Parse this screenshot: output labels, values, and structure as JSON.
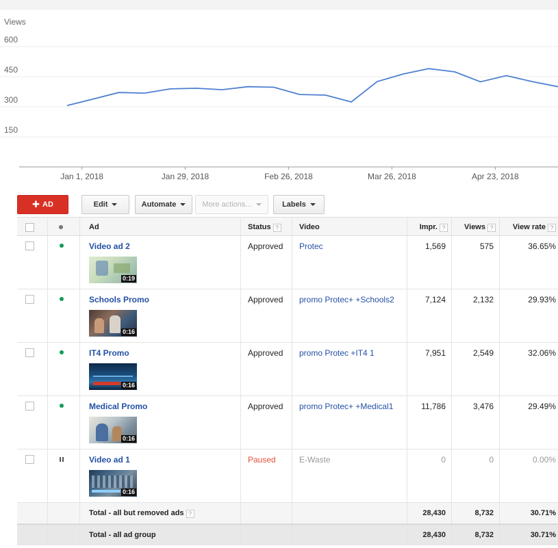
{
  "chart_data": {
    "type": "line",
    "ylabel": "Views",
    "yticks": [
      600,
      450,
      300,
      150
    ],
    "ylim": [
      0,
      650
    ],
    "xticks": [
      "Jan 1, 2018",
      "Jan 29, 2018",
      "Feb 26, 2018",
      "Mar 26, 2018",
      "Apr 23, 2018"
    ],
    "x": [
      "2017-12-28",
      "2018-01-04",
      "2018-01-11",
      "2018-01-18",
      "2018-01-25",
      "2018-02-01",
      "2018-02-08",
      "2018-02-15",
      "2018-02-22",
      "2018-03-01",
      "2018-03-08",
      "2018-03-15",
      "2018-03-22",
      "2018-03-29",
      "2018-04-05",
      "2018-04-12",
      "2018-04-19",
      "2018-04-26",
      "2018-05-03",
      "2018-05-10"
    ],
    "values": [
      306,
      338,
      371,
      368,
      389,
      392,
      385,
      400,
      397,
      361,
      358,
      324,
      425,
      463,
      490,
      474,
      424,
      455,
      425,
      400
    ],
    "color": "#4d7fd1",
    "grid": true
  },
  "toolbar": {
    "add_label": "AD",
    "edit_label": "Edit",
    "automate_label": "Automate",
    "more_label": "More actions...",
    "labels_label": "Labels"
  },
  "table": {
    "headers": {
      "ad": "Ad",
      "status": "Status",
      "video": "Video",
      "impr": "Impr.",
      "views": "Views",
      "view_rate": "View rate"
    },
    "help_glyph": "?",
    "rows": [
      {
        "name": "Video ad 2",
        "duration": "0:19",
        "status": "Approved",
        "video": "Protec",
        "impr": "1,569",
        "views": "575",
        "view_rate": "36.65%"
      },
      {
        "name": "Schools Promo",
        "duration": "0:16",
        "status": "Approved",
        "video": "promo Protec+ +Schools2",
        "impr": "7,124",
        "views": "2,132",
        "view_rate": "29.93%"
      },
      {
        "name": "IT4 Promo",
        "duration": "0:16",
        "status": "Approved",
        "video": "promo Protec +IT4 1",
        "impr": "7,951",
        "views": "2,549",
        "view_rate": "32.06%"
      },
      {
        "name": "Medical Promo",
        "duration": "0:16",
        "status": "Approved",
        "video": "promo Protec+ +Medical1",
        "impr": "11,786",
        "views": "3,476",
        "view_rate": "29.49%"
      },
      {
        "name": "Video ad 1",
        "duration": "0:16",
        "status": "Paused",
        "video": "E-Waste",
        "impr": "0",
        "views": "0",
        "view_rate": "0.00%"
      }
    ],
    "total_removed": {
      "label": "Total - all but removed ads",
      "impr": "28,430",
      "views": "8,732",
      "view_rate": "30.71%"
    },
    "total_group": {
      "label": "Total - all ad group",
      "impr": "28,430",
      "views": "8,732",
      "view_rate": "30.71%"
    }
  },
  "colors": {
    "accent_red": "#d93025",
    "link_blue": "#2350a5",
    "enabled_green": "#0f9d58",
    "paused_red": "#e3503c"
  }
}
